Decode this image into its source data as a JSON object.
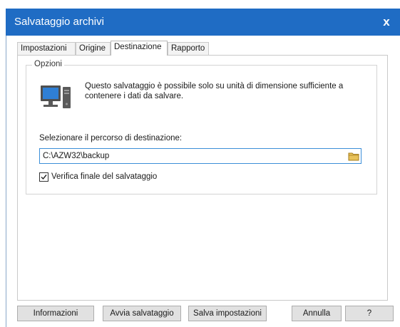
{
  "window": {
    "title": "Salvataggio archivi",
    "close_glyph": "x"
  },
  "tabs": [
    {
      "label": "Impostazioni",
      "active": false
    },
    {
      "label": "Origine",
      "active": false
    },
    {
      "label": "Destinazione",
      "active": true
    },
    {
      "label": "Rapporto",
      "active": false
    }
  ],
  "options_group": {
    "title": "Opzioni",
    "info_text": "Questo salvataggio è possibile solo su unità di dimensione sufficiente a contenere i dati da salvare.",
    "icon": "computer-icon",
    "path_label": "Selezionare il percorso di destinazione:",
    "path_value": "C:\\AZW32\\backup",
    "browse_icon": "folder-icon",
    "verify_checkbox": {
      "label": "Verifica finale del salvataggio",
      "checked": true
    }
  },
  "buttons": {
    "info": "Informazioni",
    "start_backup": "Avvia salvataggio",
    "save_settings": "Salva impostazioni",
    "cancel": "Annulla",
    "help": "?"
  },
  "colors": {
    "titlebar": "#1f6cc4",
    "input_focus_border": "#3b8ed8"
  }
}
